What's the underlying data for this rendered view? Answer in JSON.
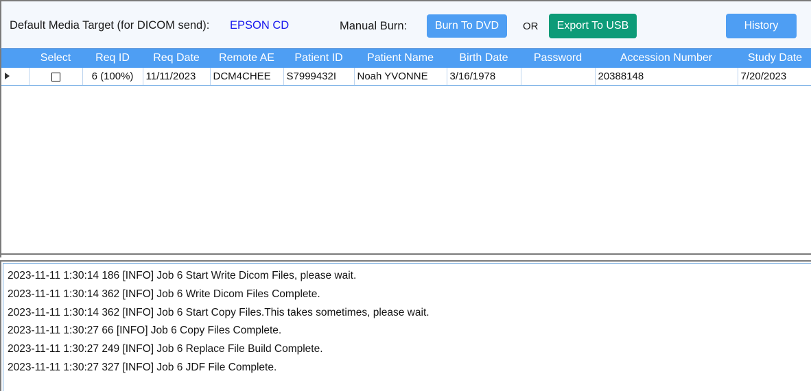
{
  "toolbar": {
    "media_target_label": "Default Media Target (for DICOM send):",
    "media_target_value": "EPSON CD",
    "manual_burn_label": "Manual Burn:",
    "burn_to_dvd_label": "Burn To DVD",
    "or_label": "OR",
    "export_to_usb_label": "Export To USB",
    "history_label": "History",
    "colors": {
      "primary_blue": "#4e9ef3",
      "export_green": "#0d9b78",
      "link_blue": "#1616ee",
      "toolbar_bg": "#f4f8fd"
    }
  },
  "grid": {
    "columns": [
      "Select",
      "Req ID",
      "Req Date",
      "Remote AE",
      "Patient ID",
      "Patient Name",
      "Birth Date",
      "Password",
      "Accession Number",
      "Study Date"
    ],
    "rows": [
      {
        "selected": false,
        "current": true,
        "req_id": "6  (100%)",
        "req_date": "11/11/2023",
        "remote_ae": "DCM4CHEE",
        "patient_id": "S7999432I",
        "patient_name": "Noah YVONNE",
        "birth_date": "3/16/1978",
        "password": "",
        "accession_number": "20388148",
        "study_date": "7/20/2023"
      }
    ],
    "header_bg": "#4e9ef3",
    "selected_cell_bg": "#3f97f6"
  },
  "log": {
    "lines": [
      "2023-11-11 1:30:14 186 [INFO] Job 6 Start Write Dicom Files, please wait.",
      "2023-11-11 1:30:14 362 [INFO] Job 6 Write Dicom Files Complete.",
      "2023-11-11 1:30:14 362 [INFO] Job 6 Start Copy Files.This takes sometimes, please wait.",
      "2023-11-11 1:30:27 66 [INFO] Job 6 Copy Files Complete.",
      "2023-11-11 1:30:27 249 [INFO] Job 6 Replace File Build Complete.",
      "2023-11-11 1:30:27 327 [INFO] Job 6 JDF File Complete."
    ]
  }
}
